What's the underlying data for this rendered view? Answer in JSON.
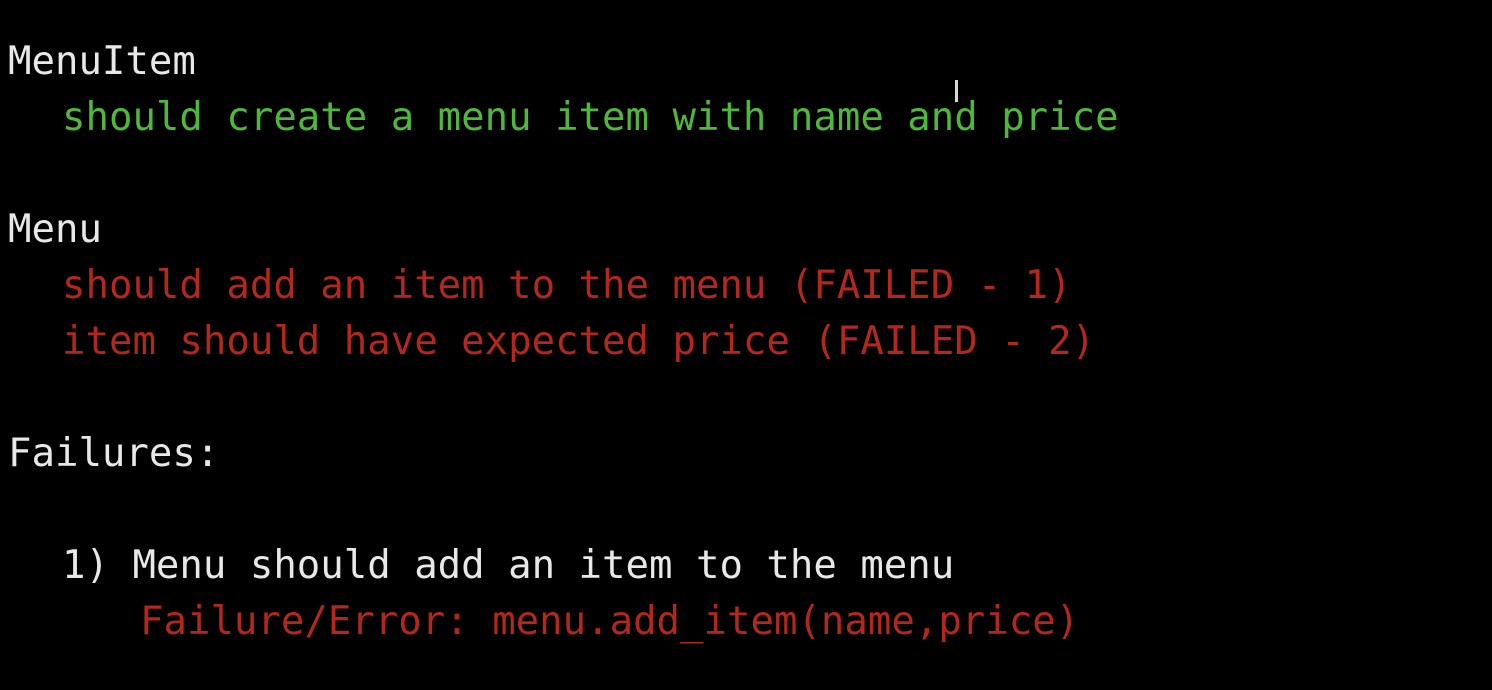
{
  "terminal": {
    "suites": [
      {
        "name": "MenuItem",
        "tests": [
          {
            "text": "should create a menu item with name and price",
            "status": "passed",
            "color": "#4fb83a"
          }
        ]
      },
      {
        "name": "Menu",
        "tests": [
          {
            "text": "should add an item to the menu (FAILED - 1)",
            "status": "failed",
            "color": "#b3271c"
          },
          {
            "text": "item should have expected price (FAILED - 2)",
            "status": "failed",
            "color": "#b3271c"
          }
        ]
      }
    ],
    "failures": {
      "heading": "Failures:",
      "items": [
        {
          "label": "1) Menu should add an item to the menu",
          "error": "Failure/Error: menu.add_item(name,price)"
        }
      ]
    }
  }
}
